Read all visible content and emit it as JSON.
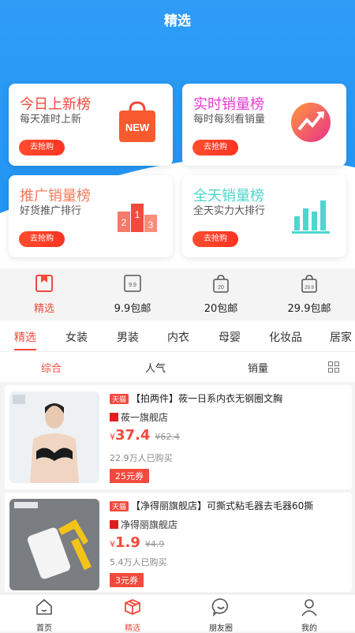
{
  "header": {
    "title": "精选"
  },
  "cards": [
    {
      "title": "今日上新榜",
      "subtitle": "每天准时上新",
      "button": "去抢购",
      "color": "#f24a3d",
      "icon": "new-bag-icon"
    },
    {
      "title": "实时销量榜",
      "subtitle": "每时每刻看销量",
      "button": "去抢购",
      "color": "#e83ad6",
      "icon": "trend-up-icon"
    },
    {
      "title": "推广销量榜",
      "subtitle": "好货推广排行",
      "button": "去抢购",
      "color": "#f57a5a",
      "icon": "podium-icon"
    },
    {
      "title": "全天销量榜",
      "subtitle": "全天实力大排行",
      "button": "去抢购",
      "color": "#4fd5d0",
      "icon": "bar-chart-icon"
    }
  ],
  "categories": [
    {
      "label": "精选",
      "icon": "featured-icon",
      "active": true
    },
    {
      "label": "9.9包邮",
      "icon": "price-9-9-icon"
    },
    {
      "label": "20包邮",
      "icon": "price-20-icon"
    },
    {
      "label": "29.9包邮",
      "icon": "price-29-9-icon"
    }
  ],
  "price_badges": {
    "a": "9.9",
    "b": "20",
    "c": "29.9"
  },
  "tabs": [
    "精选",
    "女装",
    "男装",
    "内衣",
    "母婴",
    "化妆品",
    "居家"
  ],
  "sort": [
    "综合",
    "人气",
    "销量"
  ],
  "products": [
    {
      "badge": "天猫",
      "name": "【拍两件】莜一日系内衣无钢圈文胸",
      "shop": "莜一旗舰店",
      "currency": "¥",
      "price": "37.4",
      "old_price": "¥62.4",
      "sold": "22.9万人已购买",
      "coupon": "25元券"
    },
    {
      "badge": "天猫",
      "name": "【净得丽旗舰店】可撕式粘毛器去毛器60撕",
      "shop": "净得丽旗舰店",
      "currency": "¥",
      "price": "1.9",
      "old_price": "¥4.9",
      "sold": "5.4万人已购买",
      "coupon": "3元券"
    }
  ],
  "bottom_nav": [
    {
      "label": "首页",
      "icon": "home-icon"
    },
    {
      "label": "精选",
      "icon": "box-icon",
      "active": true
    },
    {
      "label": "朋友圈",
      "icon": "chat-bubble-icon"
    },
    {
      "label": "我的",
      "icon": "person-icon"
    }
  ],
  "colors": {
    "primary": "#1c8ff0",
    "accent": "#f24a3d"
  }
}
